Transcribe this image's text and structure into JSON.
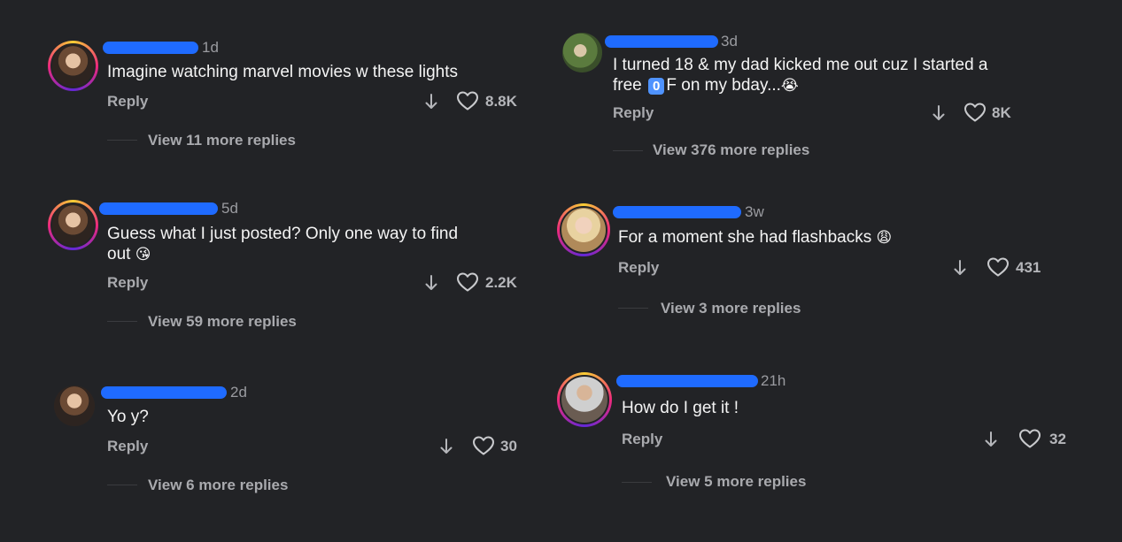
{
  "ui": {
    "reply_label": "Reply"
  },
  "comments": [
    {
      "time": "1d",
      "text": "Imagine watching marvel movies w these lights",
      "likes": "8.8K",
      "view_replies": "View 11 more replies"
    },
    {
      "time": "5d",
      "text_line1": "Guess what I just posted? Only one way to find",
      "text_line2": "out",
      "emoji": "😘",
      "likes": "2.2K",
      "view_replies": "View 59 more replies"
    },
    {
      "time": "2d",
      "text": "Yo y?",
      "likes": "30",
      "view_replies": "View 6 more replies"
    },
    {
      "time": "3d",
      "text_line1": "I turned 18 & my dad kicked me out cuz I started a",
      "text_part_a": "free",
      "badge": "0",
      "text_part_b": "F on my bday...",
      "emoji": "😭",
      "likes": "8K",
      "view_replies": "View 376 more replies"
    },
    {
      "time": "3w",
      "text": "For a moment she had flashbacks",
      "emoji": "😩",
      "likes": "431",
      "view_replies": "View 3 more replies"
    },
    {
      "time": "21h",
      "text": "How do I get it !",
      "likes": "32",
      "view_replies": "View 5 more replies"
    }
  ],
  "icons": {
    "downvote": "arrow-down-icon",
    "like": "heart-outline-icon"
  },
  "colors": {
    "background": "#222326",
    "redaction": "#1f6bff",
    "story_ring": "#ee2a7b",
    "badge": "#4f93ff"
  }
}
